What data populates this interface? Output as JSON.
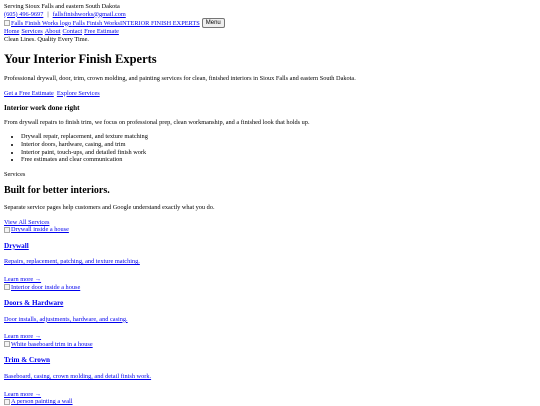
{
  "topbar": {
    "service_area": "Serving Sioux Falls and eastern South Dakota",
    "phone": "(605) 496-9697",
    "divider": "|",
    "email": "fallsfinishworks@gmail.com"
  },
  "header": {
    "logo_alt": "Falls Finish Works logo",
    "brand_name": "Falls Finish Works",
    "brand_tagline": "INTERIOR FINISH EXPERTS",
    "menu_button": "Menu"
  },
  "nav": {
    "items": [
      {
        "label": "Home"
      },
      {
        "label": "Services"
      },
      {
        "label": "About"
      },
      {
        "label": "Contact"
      },
      {
        "label": "Free Estimate"
      }
    ]
  },
  "slogan": "Clean Lines. Quality Every Time.",
  "hero": {
    "title": "Your Interior Finish Experts",
    "description": "Professional drywall, door, trim, crown molding, and painting services for clean, finished interiors in Sioux Falls and eastern South Dakota.",
    "primary_cta": "Get a Free Estimate",
    "secondary_cta": "Explore Services"
  },
  "intro": {
    "heading": "Interior work done right",
    "text": "From drywall repairs to finish trim, we focus on professional prep, clean workmanship, and a finished look that holds up.",
    "bullets": [
      "Drywall repair, replacement, and texture matching",
      "Interior doors, hardware, casing, and trim",
      "Interior paint, touch-ups, and detailed finish work",
      "Free estimates and clear communication"
    ]
  },
  "services": {
    "eyebrow": "Services",
    "heading": "Built for better interiors.",
    "text": "Separate service pages help customers and Google understand exactly what you do.",
    "view_all": "View All Services",
    "learn_more": "Learn more →",
    "cards": [
      {
        "image_alt": "Drywall inside a house",
        "title": "Drywall",
        "description": "Repairs, replacement, patching, and texture matching."
      },
      {
        "image_alt": "Interior door inside a house",
        "title": "Doors & Hardware",
        "description": "Door installs, adjustments, hardware, and casing."
      },
      {
        "image_alt": "White baseboard trim in a house",
        "title": "Trim & Crown",
        "description": "Baseboard, casing, crown molding, and detail finish work."
      }
    ],
    "next_image_alt": "A person painting a wall"
  }
}
